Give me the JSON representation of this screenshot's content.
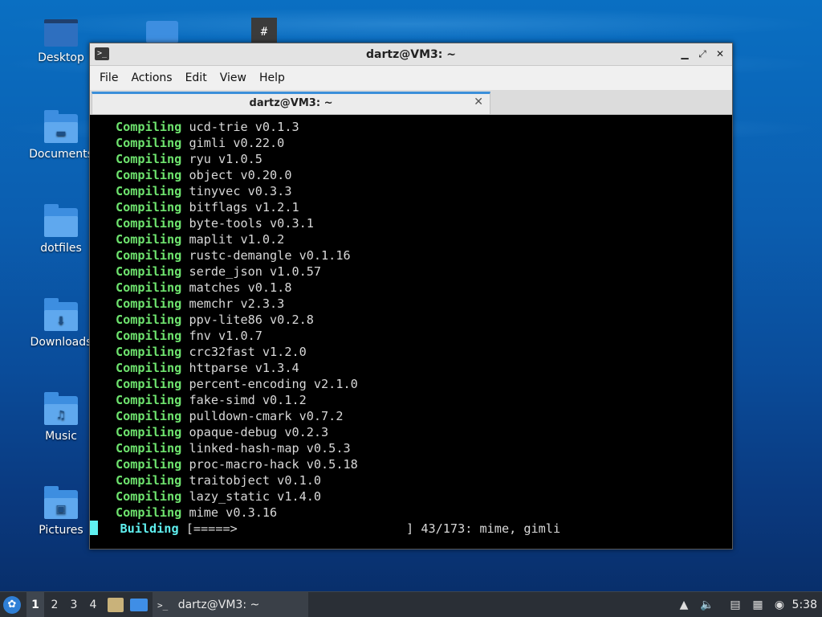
{
  "desktop": {
    "icons": [
      {
        "label": "Desktop",
        "icon": "desktop-folder-icon"
      },
      {
        "label": "Documents",
        "icon": "documents-folder-icon"
      },
      {
        "label": "dotfiles",
        "icon": "folder-icon"
      },
      {
        "label": "Downloads",
        "icon": "downloads-folder-icon"
      },
      {
        "label": "Music",
        "icon": "music-folder-icon"
      },
      {
        "label": "Pictures",
        "icon": "pictures-folder-icon"
      }
    ]
  },
  "window": {
    "title": "dartz@VM3: ~",
    "menu": [
      "File",
      "Actions",
      "Edit",
      "View",
      "Help"
    ],
    "tab_title": "dartz@VM3: ~",
    "tab_close": "✕"
  },
  "terminal": {
    "keyword": "Compiling",
    "lines": [
      "ucd-trie v0.1.3",
      "gimli v0.22.0",
      "ryu v1.0.5",
      "object v0.20.0",
      "tinyvec v0.3.3",
      "bitflags v1.2.1",
      "byte-tools v0.3.1",
      "maplit v1.0.2",
      "rustc-demangle v0.1.16",
      "serde_json v1.0.57",
      "matches v0.1.8",
      "memchr v2.3.3",
      "ppv-lite86 v0.2.8",
      "fnv v1.0.7",
      "crc32fast v1.2.0",
      "httparse v1.3.4",
      "percent-encoding v2.1.0",
      "fake-simd v0.1.2",
      "pulldown-cmark v0.7.2",
      "opaque-debug v0.2.3",
      "linked-hash-map v0.5.3",
      "proc-macro-hack v0.5.18",
      "traitobject v0.1.0",
      "lazy_static v1.4.0",
      "mime v0.3.16"
    ],
    "build_keyword": "Building",
    "build_bar": "[=====>                       ]",
    "build_status": "43/173: mime, gimli"
  },
  "taskbar": {
    "workspaces": [
      "1",
      "2",
      "3",
      "4"
    ],
    "active_workspace": "1",
    "task_title": "dartz@VM3: ~",
    "clock": "5:38"
  }
}
